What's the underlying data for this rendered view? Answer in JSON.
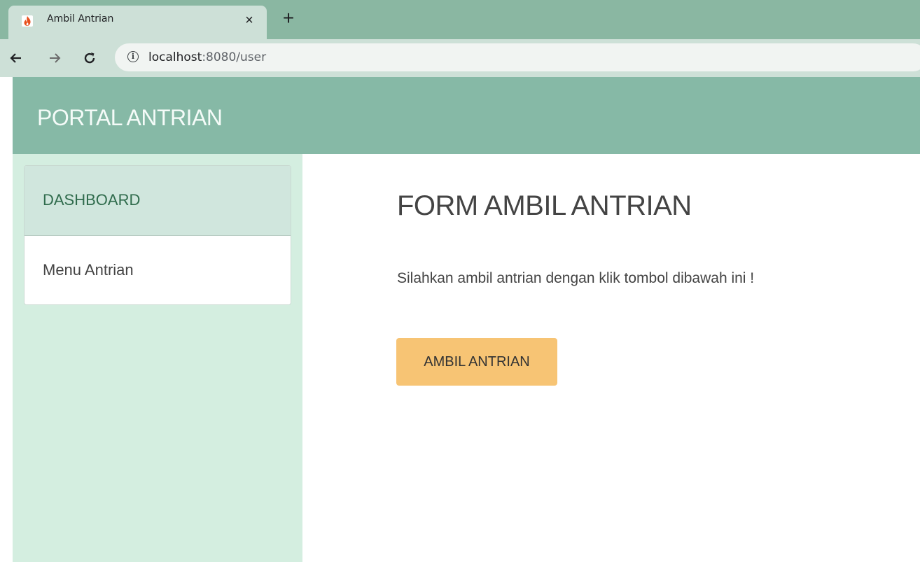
{
  "browser": {
    "tab_title": "Ambil Antrian",
    "tab_close": "×",
    "new_tab": "+",
    "url_host": "localhost",
    "url_path": ":8080/user",
    "icons": {
      "favicon": "codeigniter-flame-icon",
      "back": "arrow-left-icon",
      "forward": "arrow-right-icon",
      "reload": "reload-icon",
      "info": "info-icon"
    }
  },
  "header": {
    "brand": "PORTAL ANTRIAN"
  },
  "sidebar": {
    "items": [
      {
        "label": "DASHBOARD",
        "active": true
      },
      {
        "label": "Menu Antrian",
        "active": false
      }
    ]
  },
  "main": {
    "title": "FORM AMBIL ANTRIAN",
    "description": "Silahkan ambil antrian dengan klik tombol dibawah ini !",
    "button_label": "AMBIL ANTRIAN"
  },
  "colors": {
    "header_bg": "#86b9a6",
    "sidebar_bg": "#d4eee0",
    "active_item_bg": "#d0e6dd",
    "button_bg": "#f7c474",
    "browser_frame": "#8ab7a2"
  }
}
